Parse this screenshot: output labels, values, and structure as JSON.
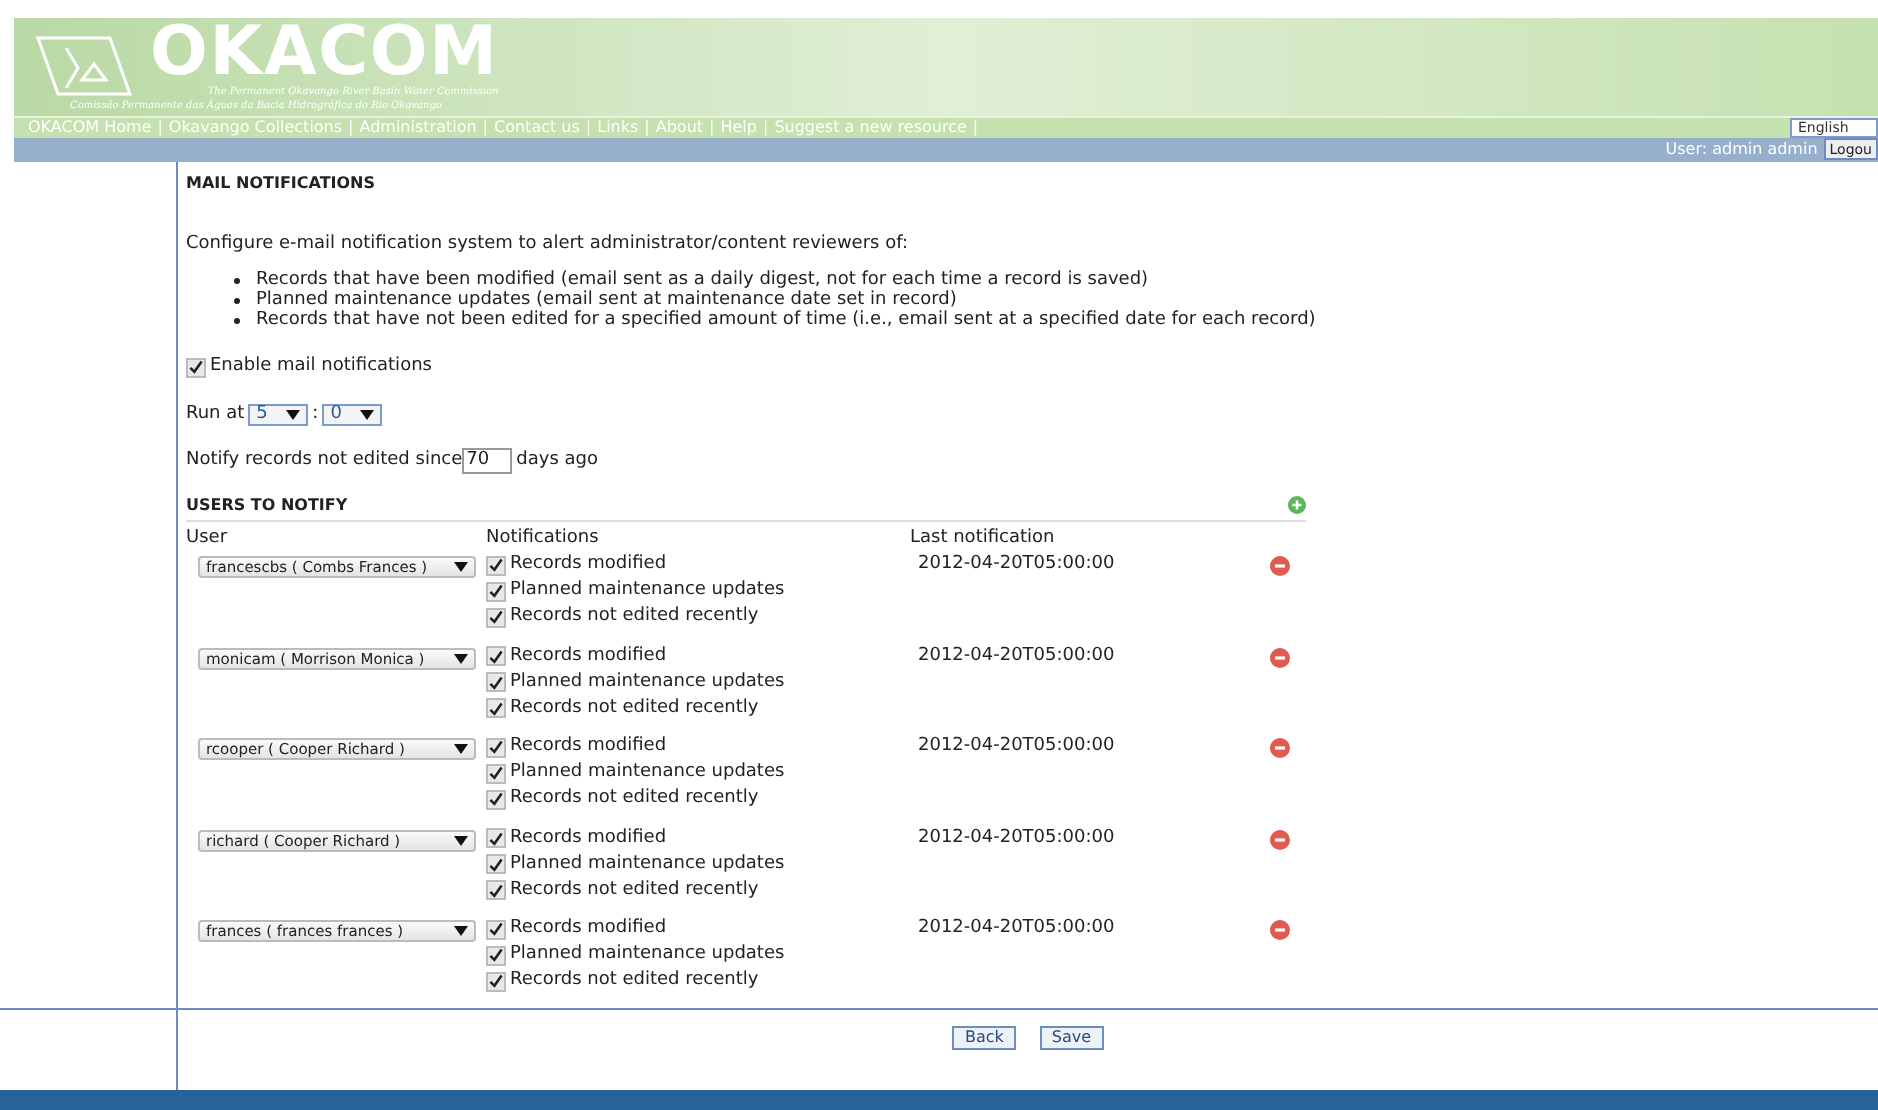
{
  "header": {
    "logo_text": "OKACOM",
    "subtitle_en": "The Permanent Okavango River Basin Water Commission",
    "subtitle_pt": "Comissão Permanente das Águas da Bacia Hidrográfica do Rio Okavango"
  },
  "nav": {
    "separator": "|",
    "links": [
      "OKACOM Home",
      "Okavango Collections",
      "Administration",
      "Contact us",
      "Links",
      "About",
      "Help",
      "Suggest a new resource"
    ]
  },
  "language": "English",
  "user_bar": {
    "user": "User: admin admin",
    "logout": "Logou"
  },
  "page_title": "MAIL NOTIFICATIONS",
  "intro": "Configure e-mail notification system to alert administrator/content reviewers of:",
  "bullets": [
    "Records that have been modified (email sent as a daily digest, not for each time a record is saved)",
    "Planned maintenance updates (email sent at maintenance date set in record)",
    "Records that have not been edited for a specified amount of time (i.e., email sent at a specified date for each record)"
  ],
  "enable": {
    "label": "Enable mail notifications",
    "checked": true
  },
  "run_at": {
    "label": "Run at",
    "hour": "5",
    "separator": ":",
    "minute": "0"
  },
  "notify": {
    "label": "Notify records not edited since",
    "value": "70",
    "suffix": "days ago"
  },
  "users_section": {
    "title": "USERS TO NOTIFY",
    "columns": [
      "User",
      "Notifications",
      "Last notification"
    ],
    "rows": [
      {
        "user": "francescbs ( Combs Frances )",
        "notifications": [
          {
            "label": "Records modified",
            "checked": true
          },
          {
            "label": "Planned maintenance updates",
            "checked": true
          },
          {
            "label": "Records not edited recently",
            "checked": true
          }
        ],
        "last": "2012-04-20T05:00:00"
      },
      {
        "user": "monicam ( Morrison Monica )",
        "notifications": [
          {
            "label": "Records modified",
            "checked": true
          },
          {
            "label": "Planned maintenance updates",
            "checked": true
          },
          {
            "label": "Records not edited recently",
            "checked": true
          }
        ],
        "last": "2012-04-20T05:00:00"
      },
      {
        "user": "rcooper ( Cooper Richard )",
        "notifications": [
          {
            "label": "Records modified",
            "checked": true
          },
          {
            "label": "Planned maintenance updates",
            "checked": true
          },
          {
            "label": "Records not edited recently",
            "checked": true
          }
        ],
        "last": "2012-04-20T05:00:00"
      },
      {
        "user": "richard ( Cooper Richard )",
        "notifications": [
          {
            "label": "Records modified",
            "checked": true
          },
          {
            "label": "Planned maintenance updates",
            "checked": true
          },
          {
            "label": "Records not edited recently",
            "checked": true
          }
        ],
        "last": "2012-04-20T05:00:00"
      },
      {
        "user": "frances ( frances frances )",
        "notifications": [
          {
            "label": "Records modified",
            "checked": true
          },
          {
            "label": "Planned maintenance updates",
            "checked": true
          },
          {
            "label": "Records not edited recently",
            "checked": true
          }
        ],
        "last": "2012-04-20T05:00:00"
      }
    ]
  },
  "buttons": [
    "Back",
    "Save"
  ]
}
